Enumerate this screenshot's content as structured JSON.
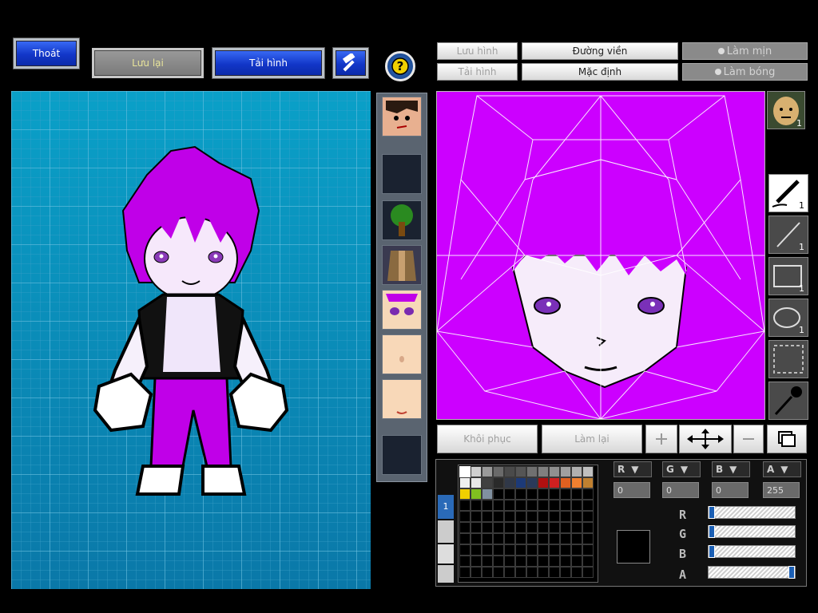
{
  "toolbar": {
    "exit_label": "Thoát",
    "save_label": "Lưu lại",
    "reload_label": "Tải hình",
    "hammer_icon": "hammer-icon",
    "help_icon": "help-icon"
  },
  "editor_toolbar": {
    "save_image": "Lưu hình",
    "load_image": "Tải hình",
    "outline": "Đường viền",
    "default": "Mặc định",
    "smooth": "Làm mịn",
    "shade": "Làm bóng"
  },
  "edit_actions": {
    "restore": "Khôi phục",
    "redo": "Làm lại"
  },
  "tools": [
    {
      "icon": "pen-icon",
      "count": "1"
    },
    {
      "icon": "line-icon",
      "count": "1"
    },
    {
      "icon": "rectangle-icon",
      "count": "1"
    },
    {
      "icon": "ellipse-icon",
      "count": "1"
    },
    {
      "icon": "selection-icon",
      "count": ""
    },
    {
      "icon": "eyedropper-icon",
      "count": ""
    }
  ],
  "avatar_badge": "1",
  "palette": {
    "layer_tab": "1",
    "colors": [
      "#ffffff",
      "#d0d0d0",
      "#9a9a9a",
      "#6a6a6a",
      "#4a4a4a",
      "#555555",
      "#707070",
      "#808080",
      "#909090",
      "#a0a0a0",
      "#b0b0b0",
      "#c0c0c0",
      "#f0f0f0",
      "#e8e8e8",
      "#404040",
      "#2a2a2a",
      "#303848",
      "#1c3a78",
      "#2a3a5a",
      "#b01010",
      "#d02020",
      "#e06020",
      "#f08030",
      "#c08030",
      "#f0d000",
      "#80c020",
      "#8090a0"
    ]
  },
  "channels": {
    "r": {
      "label": "R",
      "value": "0"
    },
    "g": {
      "label": "G",
      "value": "0"
    },
    "b": {
      "label": "B",
      "value": "0"
    },
    "a": {
      "label": "A",
      "value": "255"
    }
  },
  "slider_levels": {
    "r": 0,
    "g": 0,
    "b": 0,
    "a": 1
  }
}
